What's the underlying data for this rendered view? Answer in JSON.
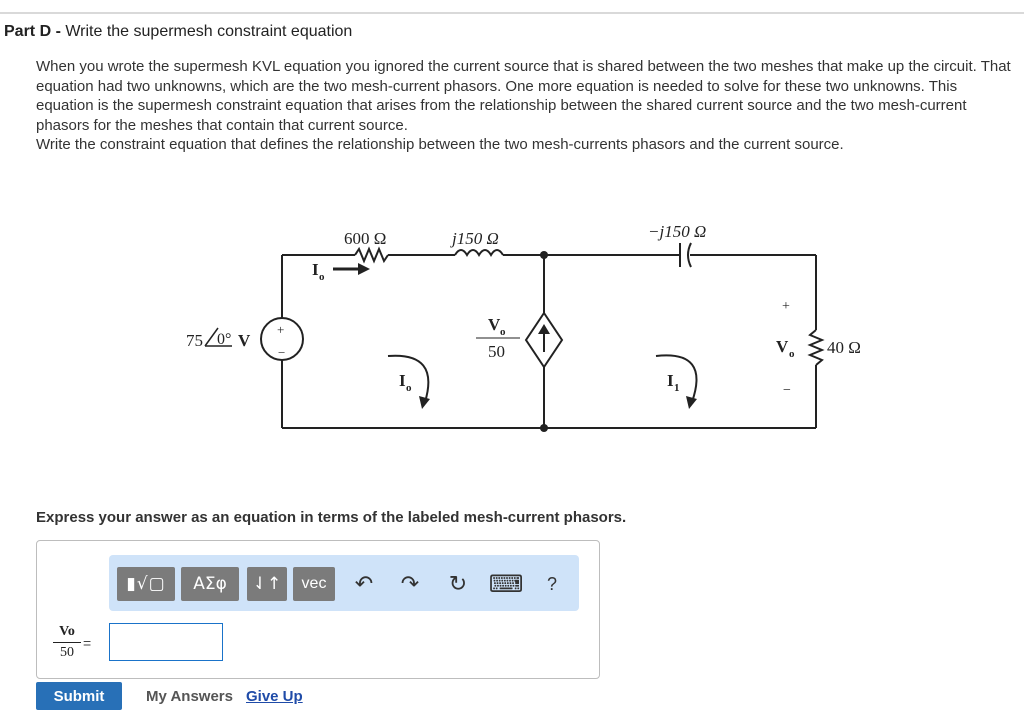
{
  "part": {
    "label": "Part D",
    "separator": " - ",
    "title": "Write the supermesh constraint equation"
  },
  "intro": {
    "paragraph": "When you wrote the supermesh KVL equation you ignored the current source that is shared between the two meshes that make up the circuit. That equation had two unknowns, which are the two mesh-current phasors. One more equation is needed to solve for these two unknowns. This equation is the supermesh constraint equation that arises from the relationship between the shared current source and the two mesh-current phasors for the meshes that contain that current source.",
    "instruction": "Write the constraint equation that defines the relationship between the two mesh-currents phasors and the current source."
  },
  "circuit": {
    "r1": "600 Ω",
    "l1": "j150 Ω",
    "c1": "−j150 Ω",
    "r2": "40 Ω",
    "source_value": "75",
    "source_angle": "0°",
    "source_unit": "V",
    "source_plus": "+",
    "source_minus": "−",
    "branch_current": "I",
    "branch_current_sub": "o",
    "dep_num": "V",
    "dep_num_sub": "o",
    "dep_den": "50",
    "mesh1": "I",
    "mesh1_sub": "o",
    "mesh2": "I",
    "mesh2_sub": "1",
    "vo_plus": "+",
    "vo_label": "V",
    "vo_sub": "o",
    "vo_minus": "−"
  },
  "prompt": "Express your answer as an equation in terms of the labeled mesh-current phasors.",
  "toolbar": {
    "templates": "▮√▢",
    "greek": "ΑΣφ",
    "arrows": "⇃↑",
    "vec": "vec",
    "undo": "↶",
    "redo": "↷",
    "reset": "↻",
    "keyboard": "⌨",
    "help": "?"
  },
  "answer": {
    "lhs_num": "Vo",
    "lhs_den": "50",
    "equals": "=",
    "value": ""
  },
  "actions": {
    "submit": "Submit",
    "my_answers": "My Answers",
    "give_up": "Give Up"
  }
}
